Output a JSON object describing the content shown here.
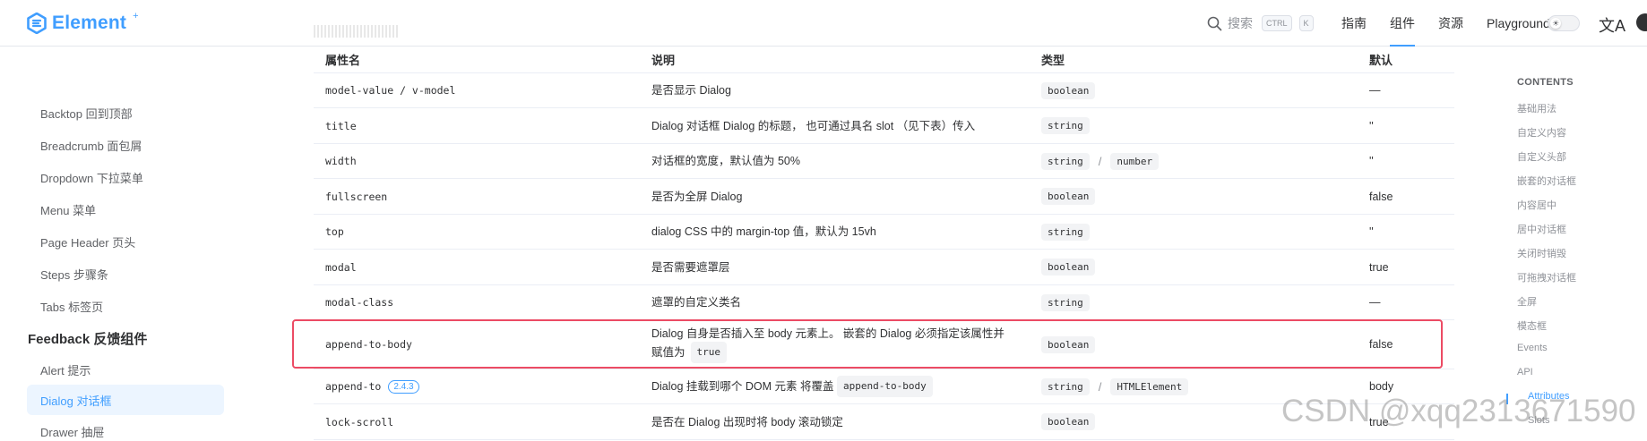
{
  "header": {
    "logo_text": "Element",
    "logo_sup": "+",
    "search_label": "搜索",
    "search_keys": [
      "CTRL",
      "K"
    ],
    "nav": [
      "指南",
      "组件",
      "资源",
      "Playground"
    ],
    "active_nav": "组件",
    "lang_icon": "文A"
  },
  "sidebar": {
    "items_top": [
      "Backtop 回到顶部",
      "Breadcrumb 面包屑",
      "Dropdown 下拉菜单",
      "Menu 菜单",
      "Page Header 页头",
      "Steps 步骤条",
      "Tabs 标签页"
    ],
    "group": "Feedback 反馈组件",
    "items_bottom": [
      "Alert 提示",
      "Dialog 对话框",
      "Drawer 抽屉"
    ],
    "active_item": "Dialog 对话框"
  },
  "table": {
    "headers": [
      "属性名",
      "说明",
      "类型",
      "默认"
    ],
    "rows": [
      {
        "name": "model-value / v-model",
        "desc": "是否显示 Dialog",
        "types": [
          "boolean"
        ],
        "default": "—"
      },
      {
        "name": "title",
        "desc": "Dialog 对话框 Dialog 的标题， 也可通过具名 slot （见下表）传入",
        "types": [
          "string"
        ],
        "default": "''"
      },
      {
        "name": "width",
        "desc": "对话框的宽度，默认值为 50%",
        "types": [
          "string",
          "number"
        ],
        "default": "''"
      },
      {
        "name": "fullscreen",
        "desc": "是否为全屏 Dialog",
        "types": [
          "boolean"
        ],
        "default": "false"
      },
      {
        "name": "top",
        "desc": "dialog CSS 中的 margin-top 值，默认为 15vh",
        "types": [
          "string"
        ],
        "default": "''"
      },
      {
        "name": "modal",
        "desc": "是否需要遮罩层",
        "types": [
          "boolean"
        ],
        "default": "true"
      },
      {
        "name": "modal-class",
        "desc": "遮罩的自定义类名",
        "types": [
          "string"
        ],
        "default": "—"
      },
      {
        "name": "append-to-body",
        "desc_line1": "Dialog 自身是否插入至 body 元素上。 嵌套的 Dialog 必须指定该属性并",
        "desc_line2": "赋值为",
        "desc_code": "true",
        "types": [
          "boolean"
        ],
        "default": "false",
        "highlighted": true
      },
      {
        "name": "append-to",
        "badge": "2.4.3",
        "desc": "Dialog 挂载到哪个 DOM 元素 将覆盖",
        "desc_code": "append-to-body",
        "types": [
          "string",
          "HTMLElement"
        ],
        "default": "body"
      },
      {
        "name": "lock-scroll",
        "desc": "是否在 Dialog 出现时将 body 滚动锁定",
        "types": [
          "boolean"
        ],
        "default": "true"
      }
    ]
  },
  "toc": {
    "title": "CONTENTS",
    "items": [
      "基础用法",
      "自定义内容",
      "自定义头部",
      "嵌套的对话框",
      "内容居中",
      "居中对话框",
      "关闭时销毁",
      "可拖拽对话框",
      "全屏",
      "模态框",
      "Events",
      "API",
      "Attributes",
      "Slots"
    ],
    "active": "Attributes"
  },
  "watermark": "CSDN @xqq2313671590",
  "colors": {
    "accent": "#409eff",
    "highlight_border": "#ec4b64",
    "active_bg": "#ecf5ff"
  }
}
